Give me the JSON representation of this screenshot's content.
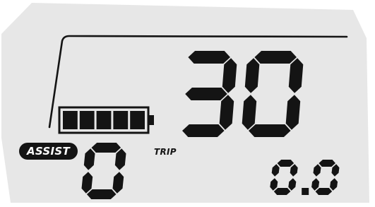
{
  "display": {
    "speed": "30",
    "assist_label": "ASSIST",
    "assist_level": "0",
    "trip_label": "TRIP",
    "trip_value": "0.0",
    "battery": {
      "bars_filled": 5,
      "bars_total": 5
    }
  },
  "colors": {
    "lcd_background": "#e7e7e7",
    "segment_on": "#141414",
    "page_background": "#ffffff"
  }
}
